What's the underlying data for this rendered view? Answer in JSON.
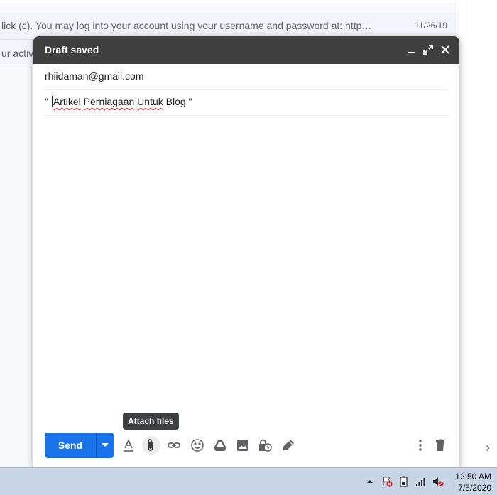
{
  "inbox": {
    "rows": [
      {
        "snippet": "lick (c). You may log into your account using your username and password at: http…",
        "date": "11/26/19"
      },
      {
        "snippet": "ur activ",
        "date": ""
      }
    ]
  },
  "compose": {
    "title": "Draft saved",
    "to": "rhiidaman@gmail.com",
    "subject_prefix": "\" ",
    "subject_words": [
      "Artikel",
      "Perniagaan",
      "Untuk"
    ],
    "subject_suffix": " Blog \"",
    "send_label": "Send",
    "tooltip": "Attach files",
    "icons": [
      "minimize-icon",
      "fullscreen-icon",
      "close-icon",
      "send-options-icon",
      "formatting-icon",
      "attach-icon",
      "link-icon",
      "emoji-icon",
      "drive-icon",
      "photo-icon",
      "confidential-icon",
      "signature-icon",
      "more-options-icon",
      "discard-icon"
    ]
  },
  "taskbar": {
    "time": "12:50 AM",
    "date": "7/5/2020"
  }
}
